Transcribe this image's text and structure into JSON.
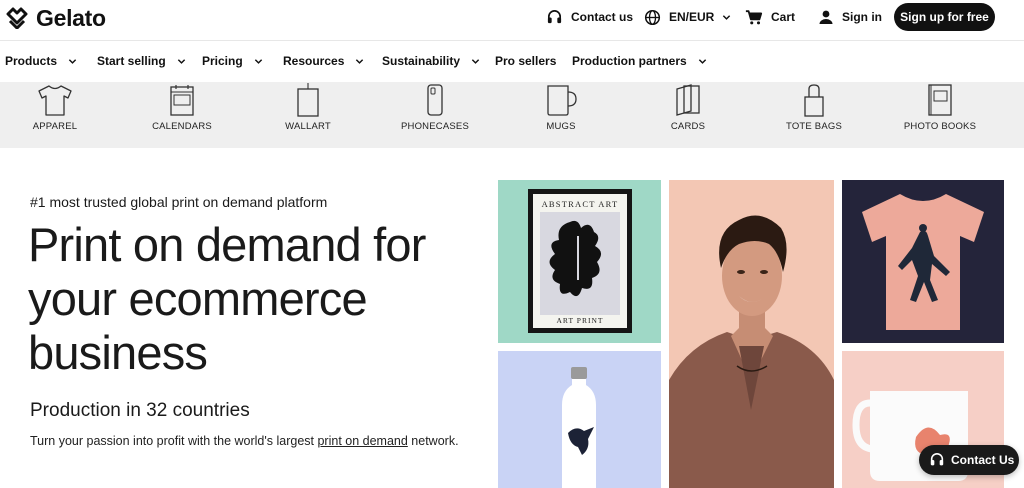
{
  "brand": {
    "name": "Gelato"
  },
  "topbar": {
    "contact_label": "Contact us",
    "locale_label": "EN/EUR",
    "cart_label": "Cart",
    "signin_label": "Sign in",
    "signup_label": "Sign up for free"
  },
  "nav": {
    "items": [
      {
        "label": "Products",
        "has_dropdown": true
      },
      {
        "label": "Start selling",
        "has_dropdown": true
      },
      {
        "label": "Pricing",
        "has_dropdown": true
      },
      {
        "label": "Resources",
        "has_dropdown": true
      },
      {
        "label": "Sustainability",
        "has_dropdown": true
      },
      {
        "label": "Pro sellers",
        "has_dropdown": false
      },
      {
        "label": "Production partners",
        "has_dropdown": true
      }
    ]
  },
  "categories": [
    {
      "label": "APPAREL",
      "icon": "tshirt-icon"
    },
    {
      "label": "CALENDARS",
      "icon": "calendar-icon"
    },
    {
      "label": "WALLART",
      "icon": "poster-icon"
    },
    {
      "label": "PHONECASES",
      "icon": "phonecase-icon"
    },
    {
      "label": "MUGS",
      "icon": "mug-icon"
    },
    {
      "label": "CARDS",
      "icon": "cards-icon"
    },
    {
      "label": "TOTE BAGS",
      "icon": "tote-bag-icon"
    },
    {
      "label": "PHOTO BOOKS",
      "icon": "photo-book-icon"
    }
  ],
  "hero": {
    "eyebrow": "#1 most trusted global print on demand platform",
    "headline": "Print on demand for your ecommerce business",
    "subheadline": "Production in 32 countries",
    "body_before_link": "Turn your passion into profit with the world's largest ",
    "body_link": "print on demand",
    "body_after_link": " network."
  },
  "gallery": {
    "poster_top_text": "ABSTRACT ART",
    "poster_bottom_text": "ART PRINT",
    "colors": {
      "poster_bg": "#9fd8c6",
      "portrait_bg": "#f3c7b4",
      "tshirt_bg": "#24243a",
      "tshirt": "#eda99a",
      "bottle_bg": "#c9d3f5",
      "mug_bg": "#f6cfc6"
    }
  },
  "floating": {
    "contact_label": "Contact Us"
  },
  "colors": {
    "primary": "#111111",
    "category_bar": "#efefef",
    "text": "#1a1a1a"
  }
}
